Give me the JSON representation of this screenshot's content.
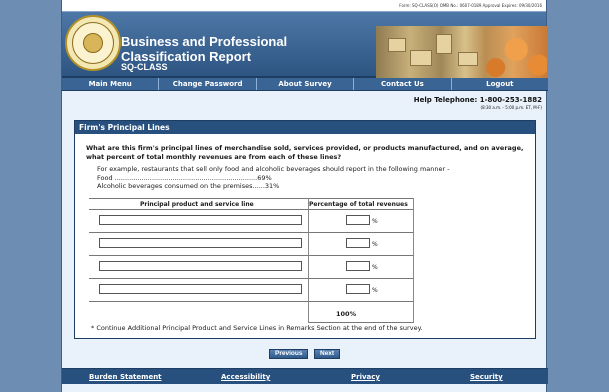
{
  "omb_notice": "Form: SQ-CLASS(O)  OMB No.: 0607-0189  Approval Expires: 09/30/2016",
  "header": {
    "title_line1": "Business and Professional",
    "title_line2": "Classification Report",
    "form_code": "SQ-CLASS",
    "seal_icon": "census-bureau-seal-icon"
  },
  "nav": [
    "Main Menu",
    "Change Password",
    "About Survey",
    "Contact Us",
    "Logout"
  ],
  "help": {
    "phone": "Help Telephone: 1-800-253-1882",
    "hours": "(8:30 a.m. - 5:00 p.m. ET, M-F)"
  },
  "panel": {
    "title": "Firm's Principal Lines",
    "question": "What are this firm's principal lines of merchandise sold, services provided, or products manufactured, and on average, what percent of total monthly revenues are from each of these lines?",
    "example_line1": "For example, restaurants that sell only food and alcoholic beverages should report in the following manner -",
    "example_line2": "Food .....................................................................69%",
    "example_line3": "Alcoholic beverages consumed on the premises......31%",
    "table": {
      "col1_header": "Principal product and service line",
      "col2_header": "Percentage of total revenues",
      "rows": [
        {
          "product": "",
          "percent": "",
          "pct_symbol": "%"
        },
        {
          "product": "",
          "percent": "",
          "pct_symbol": "%"
        },
        {
          "product": "",
          "percent": "",
          "pct_symbol": "%"
        },
        {
          "product": "",
          "percent": "",
          "pct_symbol": "%"
        }
      ],
      "total": "100%"
    },
    "footnote": "* Continue Additional Principal Product and Service Lines in Remarks Section at the end of the survey."
  },
  "buttons": {
    "previous": "Previous",
    "next": "Next"
  },
  "footer": [
    "Burden Statement",
    "Accessibility",
    "Privacy",
    "Security"
  ],
  "colors": {
    "background": "#6e8db3",
    "header_blue": "#2e5582",
    "panel_title": "#28507f",
    "content_bg": "#e9f2fb"
  }
}
